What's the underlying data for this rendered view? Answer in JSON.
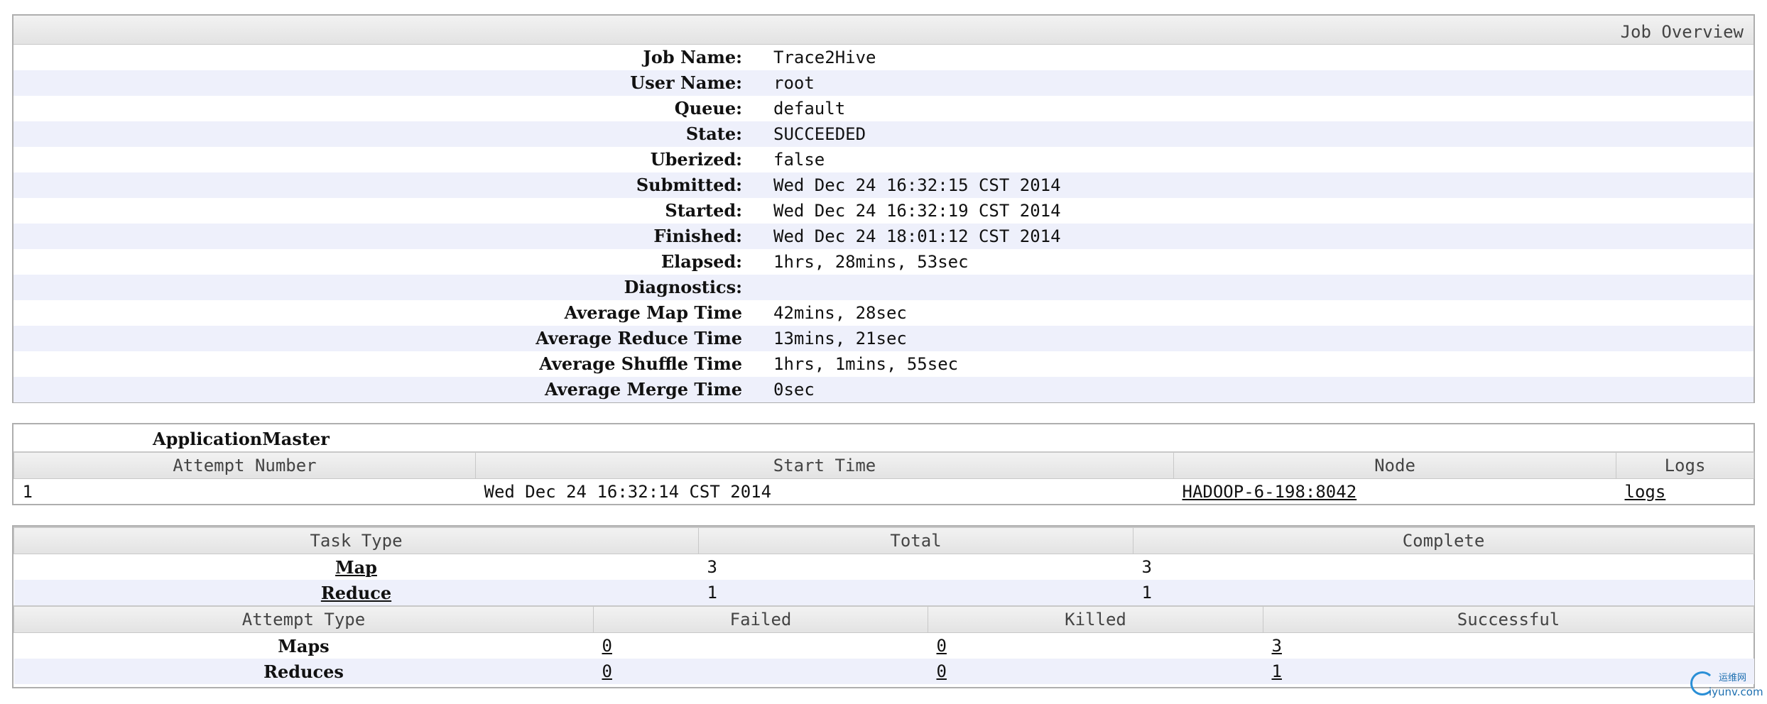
{
  "overview": {
    "title": "Job Overview",
    "rows": [
      {
        "label": "Job Name:",
        "value": "Trace2Hive"
      },
      {
        "label": "User Name:",
        "value": "root"
      },
      {
        "label": "Queue:",
        "value": "default"
      },
      {
        "label": "State:",
        "value": "SUCCEEDED"
      },
      {
        "label": "Uberized:",
        "value": "false"
      },
      {
        "label": "Submitted:",
        "value": "Wed Dec 24 16:32:15 CST 2014"
      },
      {
        "label": "Started:",
        "value": "Wed Dec 24 16:32:19 CST 2014"
      },
      {
        "label": "Finished:",
        "value": "Wed Dec 24 18:01:12 CST 2014"
      },
      {
        "label": "Elapsed:",
        "value": "1hrs, 28mins, 53sec"
      },
      {
        "label": "Diagnostics:",
        "value": ""
      },
      {
        "label": "Average Map Time",
        "value": "42mins, 28sec"
      },
      {
        "label": "Average Reduce Time",
        "value": "13mins, 21sec"
      },
      {
        "label": "Average Shuffle Time",
        "value": "1hrs, 1mins, 55sec"
      },
      {
        "label": "Average Merge Time",
        "value": "0sec"
      }
    ]
  },
  "app_master": {
    "caption": "ApplicationMaster",
    "headers": [
      "Attempt Number",
      "Start Time",
      "Node",
      "Logs"
    ],
    "row": {
      "attempt": "1",
      "start_time": "Wed Dec 24 16:32:14 CST 2014",
      "node": "HADOOP-6-198:8042",
      "logs": "logs"
    }
  },
  "tasks": {
    "headers": [
      "Task Type",
      "Total",
      "Complete"
    ],
    "rows": [
      {
        "type": "Map",
        "total": "3",
        "complete": "3"
      },
      {
        "type": "Reduce",
        "total": "1",
        "complete": "1"
      }
    ]
  },
  "attempts": {
    "headers": [
      "Attempt Type",
      "Failed",
      "Killed",
      "Successful"
    ],
    "rows": [
      {
        "type": "Maps",
        "failed": "0",
        "killed": "0",
        "successful": "3"
      },
      {
        "type": "Reduces",
        "failed": "0",
        "killed": "0",
        "successful": "1"
      }
    ]
  },
  "watermark": {
    "cn": "运维网",
    "en": "iyunv.com"
  }
}
